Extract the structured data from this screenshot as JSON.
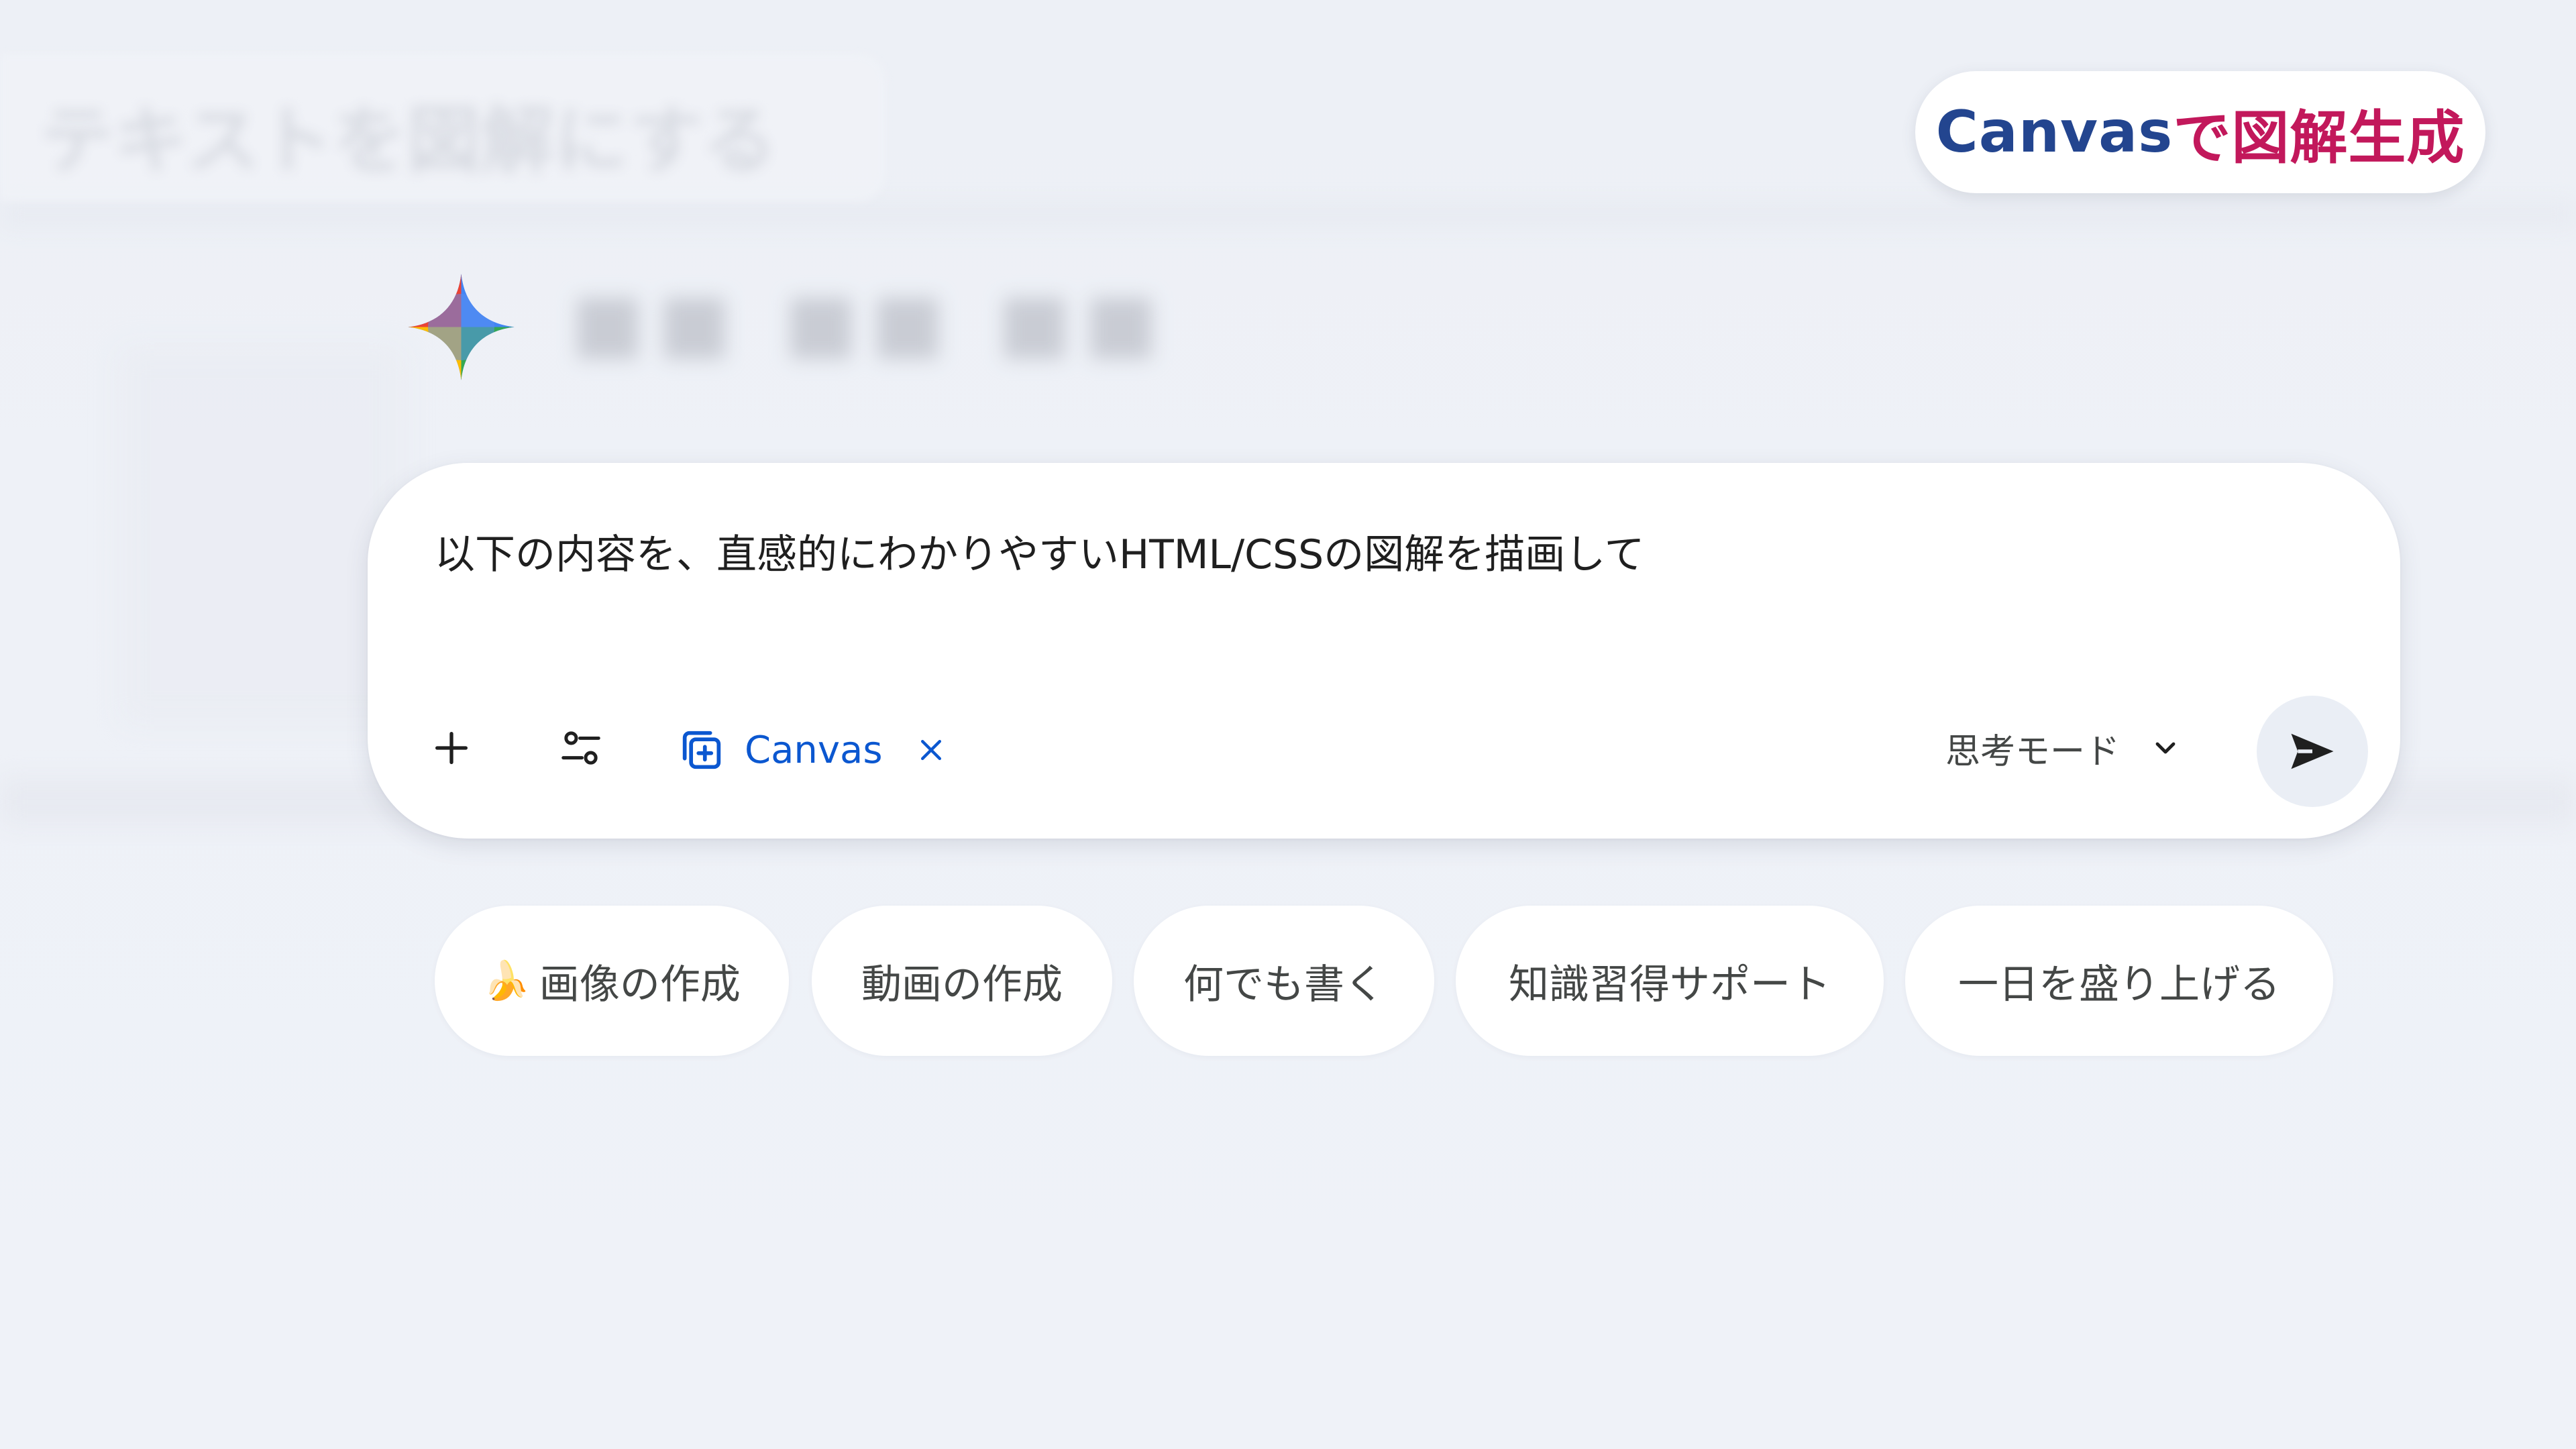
{
  "background": {
    "ghost_title": "テキストを図解にする",
    "greeting_blurred": "■■ ■■ ■■"
  },
  "badge": {
    "text_en": "Canvas",
    "text_jp": "で図解生成",
    "colors": {
      "en": "#23458f",
      "jp": "#c2185b"
    }
  },
  "logo": {
    "icon": "gemini-spark-icon"
  },
  "prompt": {
    "text": "以下の内容を、直感的にわかりやすいHTML/CSSの図解を描画して",
    "toolbar": {
      "add_icon": "plus-icon",
      "tools_icon": "tools-sliders-icon",
      "canvas_label": "Canvas",
      "canvas_icon": "canvas-icon",
      "remove_icon": "close-icon",
      "mode_label": "思考モード",
      "mode_icon": "chevron-down-icon",
      "send_icon": "send-icon"
    },
    "accent_color": "#0b57d0"
  },
  "suggestions": [
    {
      "emoji": "🍌",
      "label": "画像の作成"
    },
    {
      "emoji": "",
      "label": "動画の作成"
    },
    {
      "emoji": "",
      "label": "何でも書く"
    },
    {
      "emoji": "",
      "label": "知識習得サポート"
    },
    {
      "emoji": "",
      "label": "一日を盛り上げる"
    }
  ]
}
